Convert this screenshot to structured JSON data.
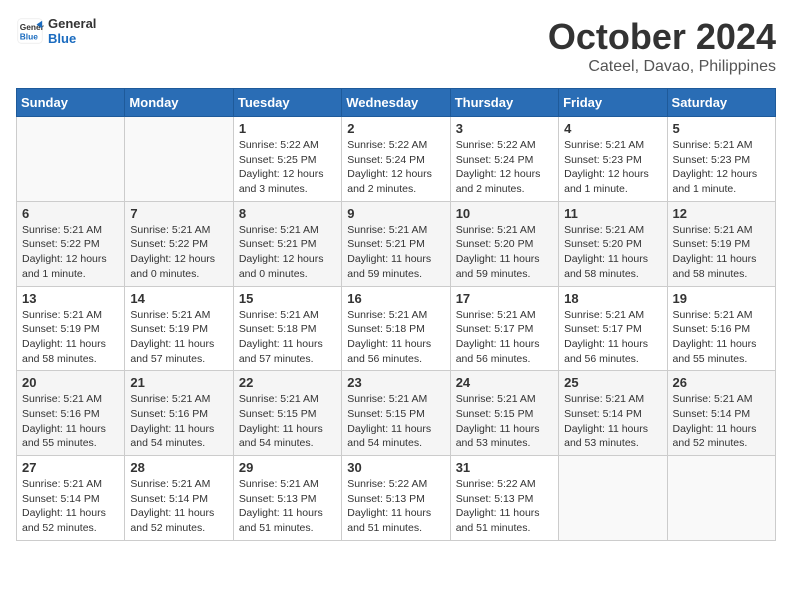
{
  "header": {
    "logo_line1": "General",
    "logo_line2": "Blue",
    "month_title": "October 2024",
    "location": "Cateel, Davao, Philippines"
  },
  "days_of_week": [
    "Sunday",
    "Monday",
    "Tuesday",
    "Wednesday",
    "Thursday",
    "Friday",
    "Saturday"
  ],
  "weeks": [
    [
      {
        "day": "",
        "info": ""
      },
      {
        "day": "",
        "info": ""
      },
      {
        "day": "1",
        "info": "Sunrise: 5:22 AM\nSunset: 5:25 PM\nDaylight: 12 hours and 3 minutes."
      },
      {
        "day": "2",
        "info": "Sunrise: 5:22 AM\nSunset: 5:24 PM\nDaylight: 12 hours and 2 minutes."
      },
      {
        "day": "3",
        "info": "Sunrise: 5:22 AM\nSunset: 5:24 PM\nDaylight: 12 hours and 2 minutes."
      },
      {
        "day": "4",
        "info": "Sunrise: 5:21 AM\nSunset: 5:23 PM\nDaylight: 12 hours and 1 minute."
      },
      {
        "day": "5",
        "info": "Sunrise: 5:21 AM\nSunset: 5:23 PM\nDaylight: 12 hours and 1 minute."
      }
    ],
    [
      {
        "day": "6",
        "info": "Sunrise: 5:21 AM\nSunset: 5:22 PM\nDaylight: 12 hours and 1 minute."
      },
      {
        "day": "7",
        "info": "Sunrise: 5:21 AM\nSunset: 5:22 PM\nDaylight: 12 hours and 0 minutes."
      },
      {
        "day": "8",
        "info": "Sunrise: 5:21 AM\nSunset: 5:21 PM\nDaylight: 12 hours and 0 minutes."
      },
      {
        "day": "9",
        "info": "Sunrise: 5:21 AM\nSunset: 5:21 PM\nDaylight: 11 hours and 59 minutes."
      },
      {
        "day": "10",
        "info": "Sunrise: 5:21 AM\nSunset: 5:20 PM\nDaylight: 11 hours and 59 minutes."
      },
      {
        "day": "11",
        "info": "Sunrise: 5:21 AM\nSunset: 5:20 PM\nDaylight: 11 hours and 58 minutes."
      },
      {
        "day": "12",
        "info": "Sunrise: 5:21 AM\nSunset: 5:19 PM\nDaylight: 11 hours and 58 minutes."
      }
    ],
    [
      {
        "day": "13",
        "info": "Sunrise: 5:21 AM\nSunset: 5:19 PM\nDaylight: 11 hours and 58 minutes."
      },
      {
        "day": "14",
        "info": "Sunrise: 5:21 AM\nSunset: 5:19 PM\nDaylight: 11 hours and 57 minutes."
      },
      {
        "day": "15",
        "info": "Sunrise: 5:21 AM\nSunset: 5:18 PM\nDaylight: 11 hours and 57 minutes."
      },
      {
        "day": "16",
        "info": "Sunrise: 5:21 AM\nSunset: 5:18 PM\nDaylight: 11 hours and 56 minutes."
      },
      {
        "day": "17",
        "info": "Sunrise: 5:21 AM\nSunset: 5:17 PM\nDaylight: 11 hours and 56 minutes."
      },
      {
        "day": "18",
        "info": "Sunrise: 5:21 AM\nSunset: 5:17 PM\nDaylight: 11 hours and 56 minutes."
      },
      {
        "day": "19",
        "info": "Sunrise: 5:21 AM\nSunset: 5:16 PM\nDaylight: 11 hours and 55 minutes."
      }
    ],
    [
      {
        "day": "20",
        "info": "Sunrise: 5:21 AM\nSunset: 5:16 PM\nDaylight: 11 hours and 55 minutes."
      },
      {
        "day": "21",
        "info": "Sunrise: 5:21 AM\nSunset: 5:16 PM\nDaylight: 11 hours and 54 minutes."
      },
      {
        "day": "22",
        "info": "Sunrise: 5:21 AM\nSunset: 5:15 PM\nDaylight: 11 hours and 54 minutes."
      },
      {
        "day": "23",
        "info": "Sunrise: 5:21 AM\nSunset: 5:15 PM\nDaylight: 11 hours and 54 minutes."
      },
      {
        "day": "24",
        "info": "Sunrise: 5:21 AM\nSunset: 5:15 PM\nDaylight: 11 hours and 53 minutes."
      },
      {
        "day": "25",
        "info": "Sunrise: 5:21 AM\nSunset: 5:14 PM\nDaylight: 11 hours and 53 minutes."
      },
      {
        "day": "26",
        "info": "Sunrise: 5:21 AM\nSunset: 5:14 PM\nDaylight: 11 hours and 52 minutes."
      }
    ],
    [
      {
        "day": "27",
        "info": "Sunrise: 5:21 AM\nSunset: 5:14 PM\nDaylight: 11 hours and 52 minutes."
      },
      {
        "day": "28",
        "info": "Sunrise: 5:21 AM\nSunset: 5:14 PM\nDaylight: 11 hours and 52 minutes."
      },
      {
        "day": "29",
        "info": "Sunrise: 5:21 AM\nSunset: 5:13 PM\nDaylight: 11 hours and 51 minutes."
      },
      {
        "day": "30",
        "info": "Sunrise: 5:22 AM\nSunset: 5:13 PM\nDaylight: 11 hours and 51 minutes."
      },
      {
        "day": "31",
        "info": "Sunrise: 5:22 AM\nSunset: 5:13 PM\nDaylight: 11 hours and 51 minutes."
      },
      {
        "day": "",
        "info": ""
      },
      {
        "day": "",
        "info": ""
      }
    ]
  ]
}
